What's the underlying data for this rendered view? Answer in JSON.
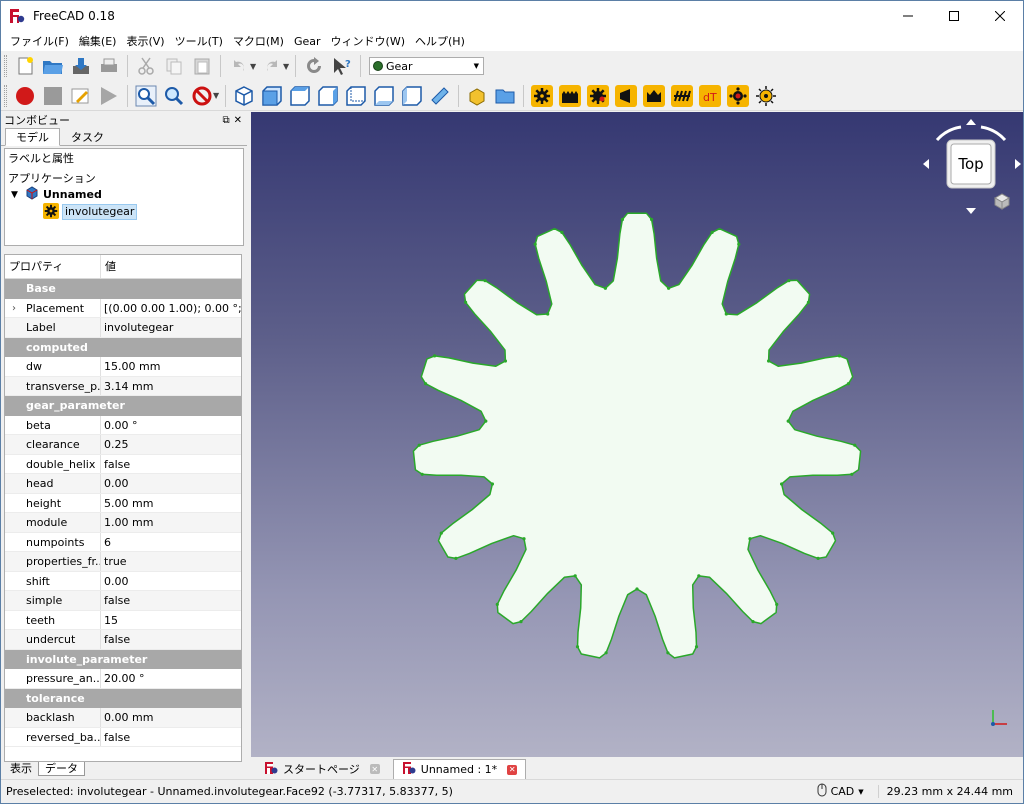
{
  "window": {
    "title": "FreeCAD 0.18"
  },
  "menu": [
    "ファイル(F)",
    "編集(E)",
    "表示(V)",
    "ツール(T)",
    "マクロ(M)",
    "Gear",
    "ウィンドウ(W)",
    "ヘルプ(H)"
  ],
  "workbench": {
    "selected": "Gear"
  },
  "combo": {
    "title": "コンボビュー",
    "tabs": [
      "モデル",
      "タスク"
    ],
    "tree_header": "ラベルと属性",
    "app_label": "アプリケーション",
    "document": "Unnamed",
    "object": "involutegear"
  },
  "properties": {
    "col_property": "プロパティ",
    "col_value": "値",
    "groups": [
      {
        "name": "Base",
        "rows": [
          {
            "name": "Placement",
            "value": "[(0.00 0.00 1.00); 0.00 °; ..."
          },
          {
            "name": "Label",
            "value": "involutegear"
          }
        ]
      },
      {
        "name": "computed",
        "rows": [
          {
            "name": "dw",
            "value": "15.00 mm"
          },
          {
            "name": "transverse_p...",
            "value": "3.14 mm"
          }
        ]
      },
      {
        "name": "gear_parameter",
        "rows": [
          {
            "name": "beta",
            "value": "0.00 °"
          },
          {
            "name": "clearance",
            "value": "0.25"
          },
          {
            "name": "double_helix",
            "value": "false"
          },
          {
            "name": "head",
            "value": "0.00"
          },
          {
            "name": "height",
            "value": "5.00 mm"
          },
          {
            "name": "module",
            "value": "1.00 mm"
          },
          {
            "name": "numpoints",
            "value": "6"
          },
          {
            "name": "properties_fr...",
            "value": "true"
          },
          {
            "name": "shift",
            "value": "0.00"
          },
          {
            "name": "simple",
            "value": "false"
          },
          {
            "name": "teeth",
            "value": "15"
          },
          {
            "name": "undercut",
            "value": "false"
          }
        ]
      },
      {
        "name": "involute_parameter",
        "rows": [
          {
            "name": "pressure_an...",
            "value": "20.00 °"
          }
        ]
      },
      {
        "name": "tolerance",
        "rows": [
          {
            "name": "backlash",
            "value": "0.00 mm"
          },
          {
            "name": "reversed_ba...",
            "value": "false"
          }
        ]
      }
    ]
  },
  "bottom_tabs": [
    "表示",
    "データ"
  ],
  "navcube": {
    "face": "Top"
  },
  "view_tabs": [
    {
      "label": "スタートページ",
      "active": false
    },
    {
      "label": "Unnamed : 1*",
      "active": true
    }
  ],
  "status": {
    "message": "Preselected: involutegear - Unnamed.involutegear.Face92 (-3.77317, 5.83377, 5)",
    "nav_style": "CAD",
    "dimensions": "29.23 mm x 24.44 mm"
  },
  "colors": {
    "gear_fill": "#f2fbf2",
    "gear_edge": "#2aa82a",
    "bg_top": "#353872",
    "bg_bottom": "#b2b2c6",
    "gear_icon_bg": "#f6b400"
  }
}
